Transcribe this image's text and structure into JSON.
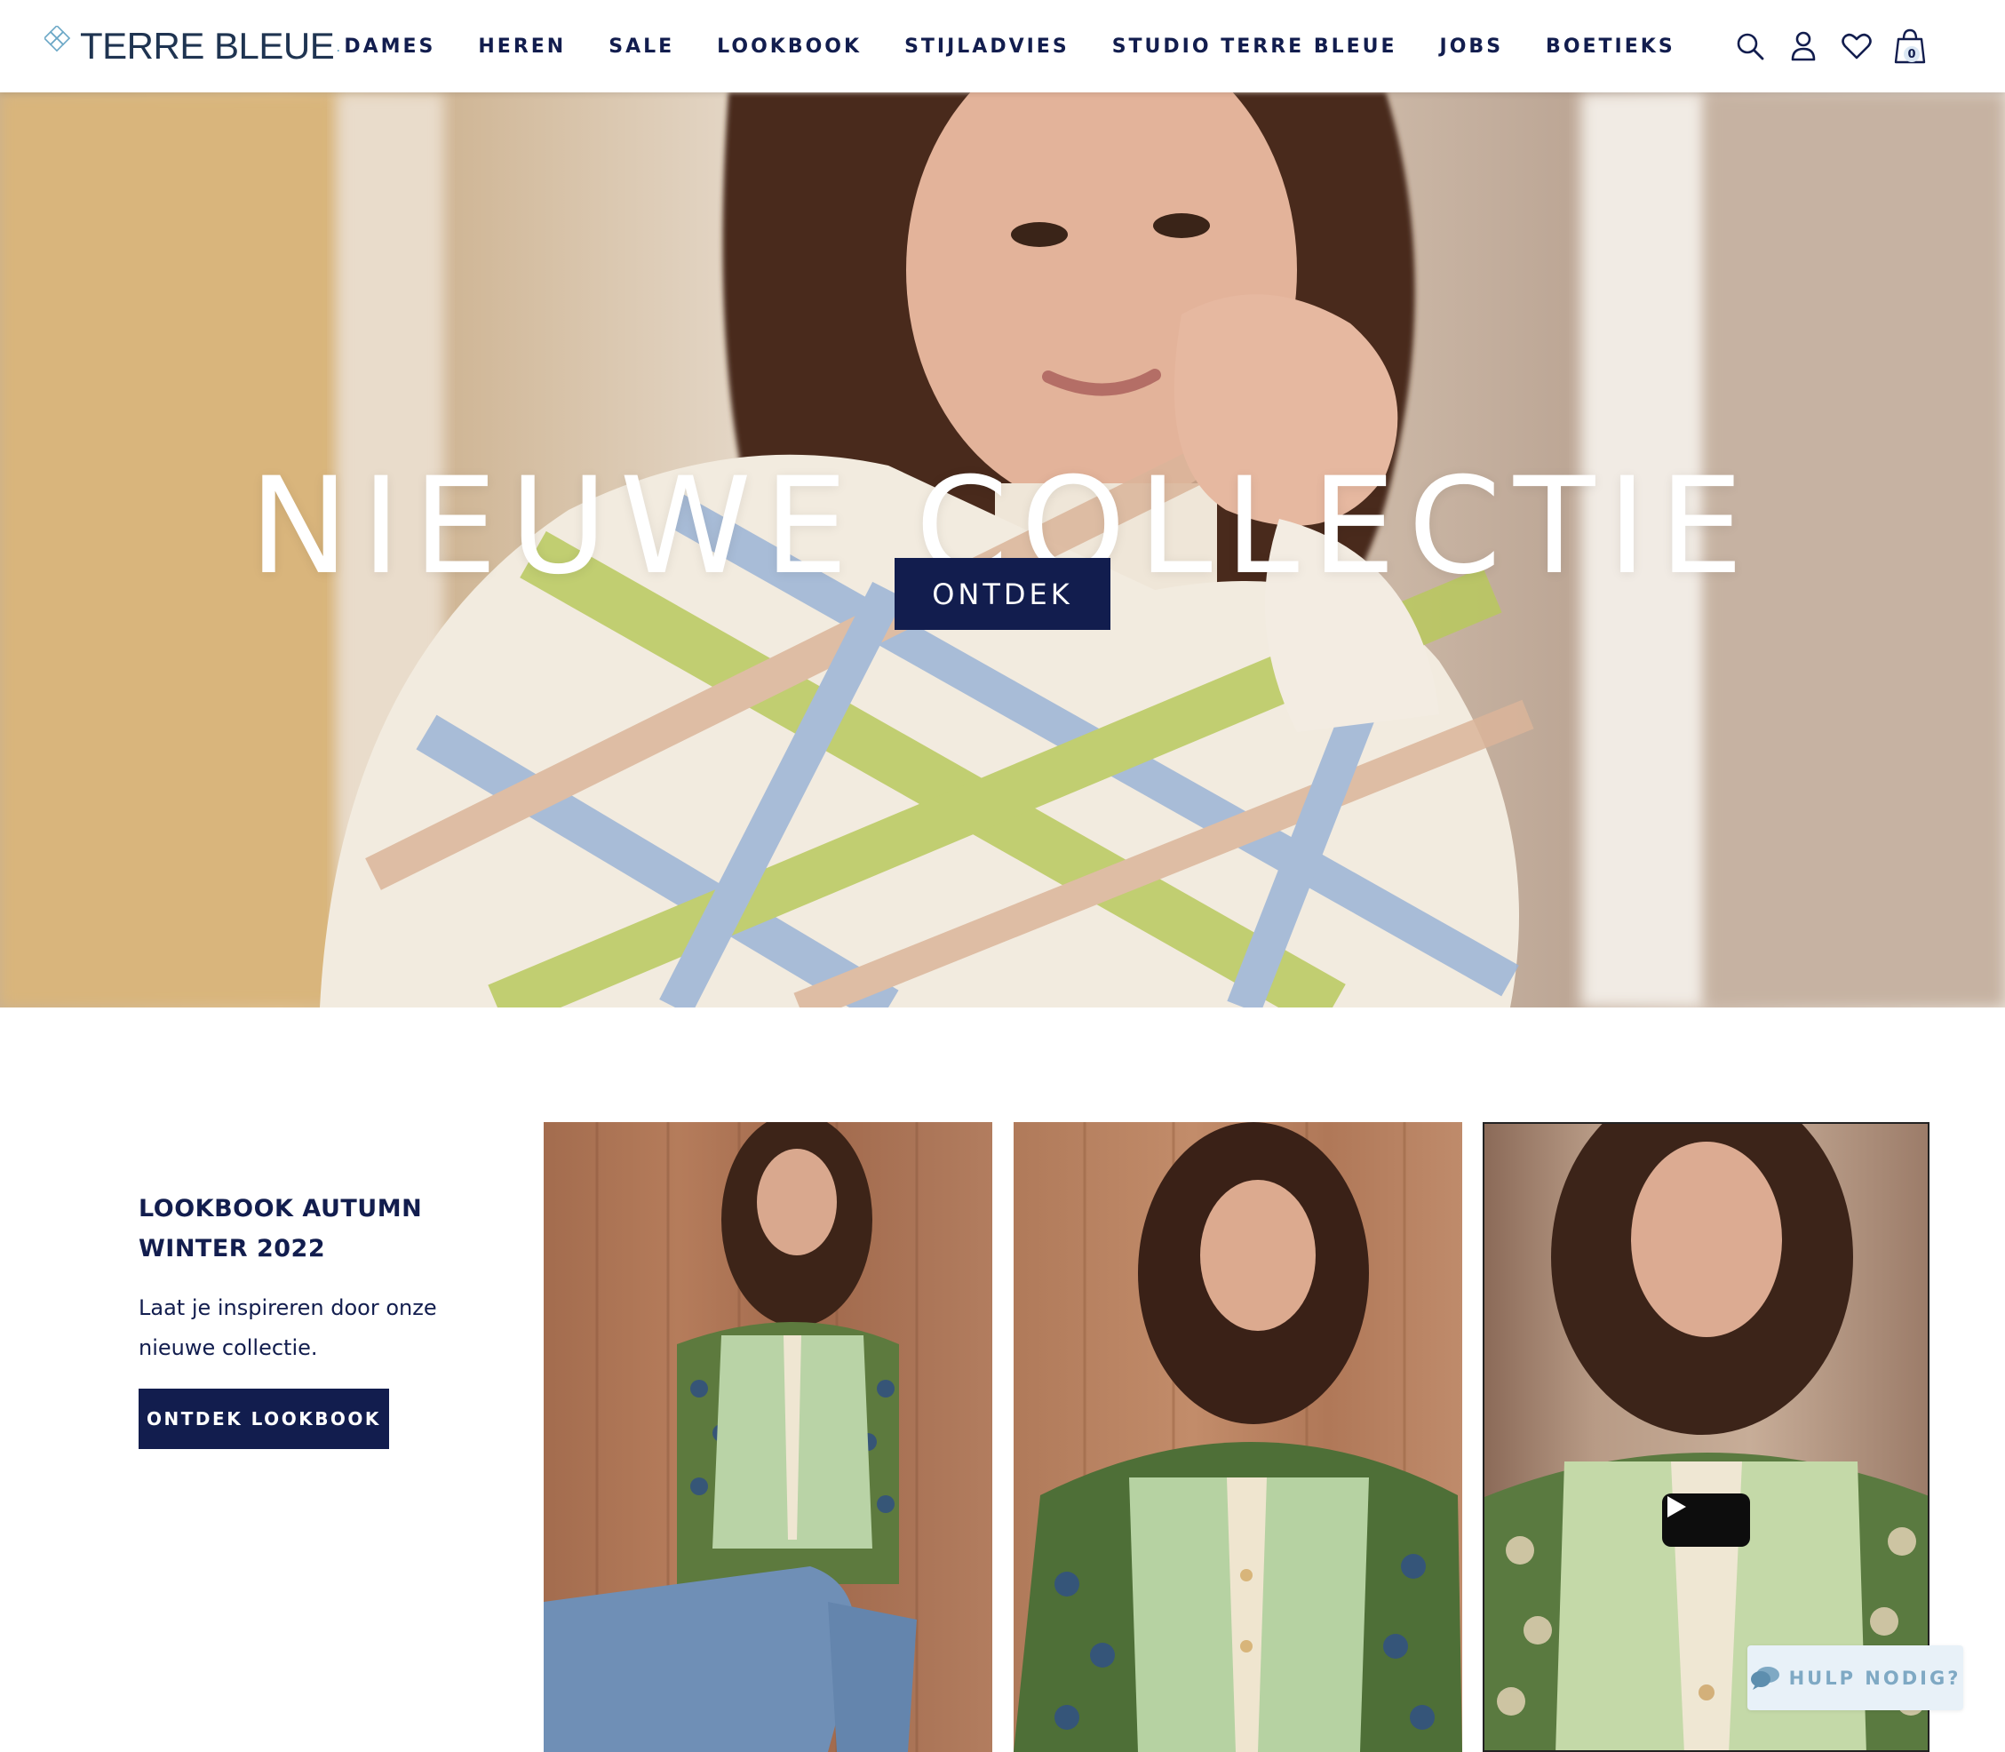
{
  "brand": {
    "name": "TERRE BLEUE",
    "mark": "."
  },
  "nav": {
    "items": [
      "DAMES",
      "HEREN",
      "SALE",
      "LOOKBOOK",
      "STIJLADVIES",
      "STUDIO TERRE BLEUE",
      "JOBS",
      "BOETIEKS"
    ]
  },
  "header_icons": {
    "search": "search-icon",
    "account": "user-icon",
    "wishlist": "heart-icon",
    "cart": "shopping-bag-icon",
    "cart_count": "0"
  },
  "hero": {
    "title": "NIEUWE COLLECTIE",
    "cta_label": "ONTDEK"
  },
  "lookbook": {
    "title": "LOOKBOOK AUTUMN WINTER 2022",
    "text": "Laat je inspireren door onze nieuwe collectie.",
    "cta_label": "ONTDEK LOOKBOOK"
  },
  "help": {
    "label": "HULP NODIG?",
    "icon": "chat-icon"
  },
  "colors": {
    "brand_navy": "#121d4e",
    "logo_text": "#1f3451",
    "logo_accent": "#6aa7c6",
    "help_bg": "#e8f1f8",
    "help_text": "#7fa9c4"
  }
}
